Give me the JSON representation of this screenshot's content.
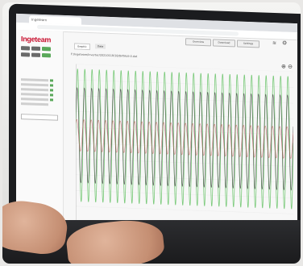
{
  "browser": {
    "tab_title": "Ingeteam"
  },
  "app": {
    "logo_text": "Ingeteam",
    "toolbar_buttons": [
      "Overview",
      "Download",
      "Settings"
    ],
    "tabs": [
      "Graphic",
      "Data"
    ],
    "file_path": "F:/Ingeteam/inverter/20210118/18/DATA/ch3.dat"
  },
  "chart_data": {
    "type": "line",
    "title": "",
    "series": [
      {
        "name": "",
        "color": "#6cc46c"
      },
      {
        "name": "",
        "color": "#444444"
      },
      {
        "name": "",
        "color": "#c45a5a"
      }
    ],
    "cycles": 30
  },
  "colors": {
    "brand": "#c8102e",
    "trace_green": "#6cc46c",
    "trace_dark": "#444444",
    "trace_red": "#c45a5a"
  }
}
